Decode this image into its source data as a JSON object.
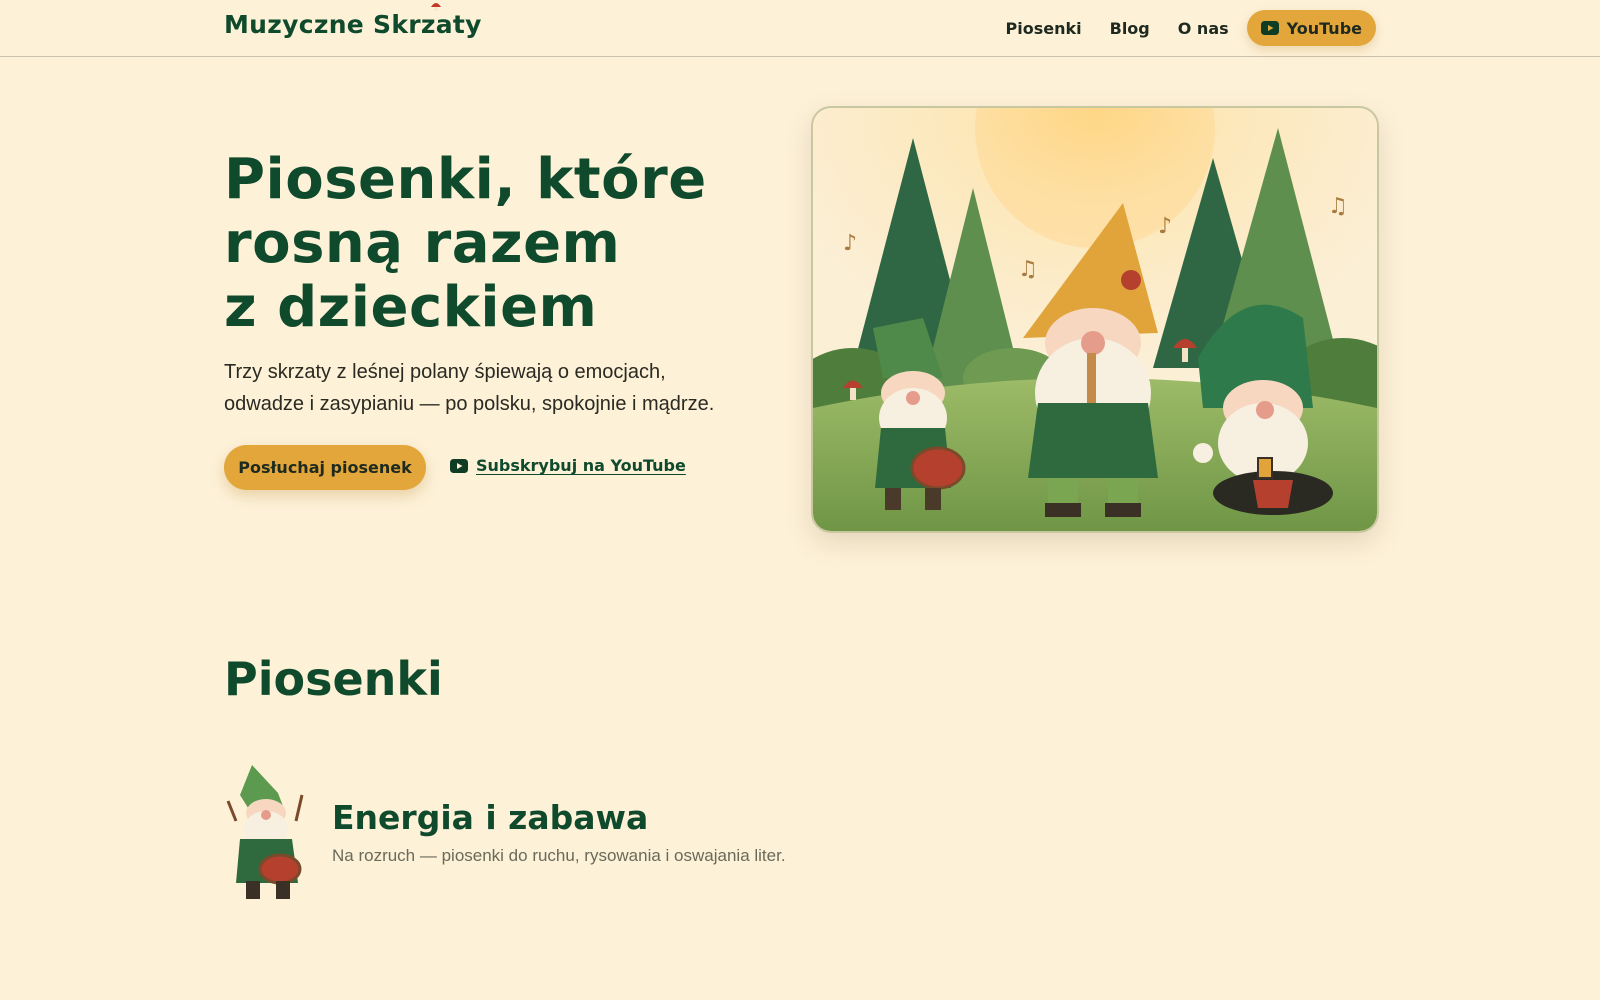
{
  "header": {
    "logo": "Muzyczne Skrzaty",
    "nav": [
      "Piosenki",
      "Blog",
      "O nas"
    ],
    "youtube_label": "YouTube"
  },
  "hero": {
    "title_lines": [
      "Piosenki, które",
      "rosną razem",
      "z dzieckiem"
    ],
    "subtitle_lines": [
      "Trzy skrzaty z leśnej polany śpiewają o emocjach,",
      "odwadze i zasypianiu — po polsku, spokojnie i mądrze."
    ],
    "cta_primary": "Posłuchaj piosenek",
    "cta_secondary": "Subskrybuj na YouTube",
    "illustration": "three-gnomes-forest-illustration"
  },
  "songs": {
    "title": "Piosenki",
    "categories": [
      {
        "title": "Energia i zabawa",
        "description": "Na rozruch — piosenki do ruchu, rysowania i oswajania liter.",
        "icon": "drummer-gnome-icon"
      }
    ]
  },
  "colors": {
    "background": "#fdf1d8",
    "brand_green": "#0f4a2c",
    "accent_mustard": "#e2a63a",
    "youtube_icon": "#0f4a2c"
  }
}
